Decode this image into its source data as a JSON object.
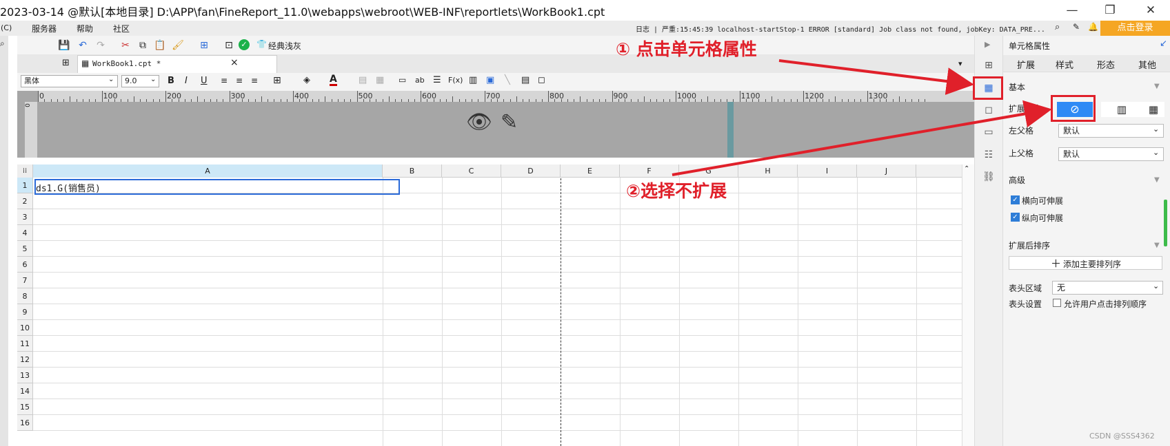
{
  "window": {
    "title": "2023-03-14 @默认[本地目录]    D:\\APP\\fan\\FineReport_11.0\\webapps\\webroot\\WEB-INF\\reportlets\\WorkBook1.cpt",
    "min": "—",
    "max": "❐",
    "close": "✕"
  },
  "menu": {
    "c": "(C)",
    "server": "服务器",
    "help": "帮助",
    "community": "社区"
  },
  "log": "日志 | 严重:15:45:39 localhost-startStop-1 ERROR [standard] Job class not found, jobKey: DATA_PRE...",
  "login": "点击登录",
  "toolbar": {
    "style_label": "经典浅灰"
  },
  "tab": {
    "name": "WorkBook1.cpt *",
    "close": "×"
  },
  "format": {
    "font": "黑体",
    "size": "9.0"
  },
  "ruler": {
    "ticks": [
      "0",
      "100",
      "200",
      "300",
      "400",
      "500",
      "600",
      "700",
      "800",
      "900",
      "1000",
      "1100",
      "1200",
      "1300"
    ],
    "vzero": "0"
  },
  "sheet": {
    "columns": [
      "A",
      "B",
      "C",
      "D",
      "E",
      "F",
      "G",
      "H",
      "I",
      "J"
    ],
    "rows": [
      "1",
      "2",
      "3",
      "4",
      "5",
      "6",
      "7",
      "8",
      "9",
      "10",
      "11",
      "12",
      "13",
      "14",
      "15",
      "16"
    ],
    "cell_a1": "ds1.G(销售员)"
  },
  "panel": {
    "title": "单元格属性",
    "tabs": [
      "扩展",
      "样式",
      "形态",
      "其他"
    ],
    "basic": "基本",
    "expand_dir": "扩展方向",
    "left_parent": "左父格",
    "left_parent_value": "默认",
    "up_parent": "上父格",
    "up_parent_value": "默认",
    "advanced": "高级",
    "h_stretch": "横向可伸展",
    "v_stretch": "纵向可伸展",
    "sort": "扩展后排序",
    "add_sort": "添加主要排列序",
    "header_area": "表头区域",
    "header_area_value": "无",
    "header_setting": "表头设置",
    "allow_sort": "允许用户点击排列顺序"
  },
  "annotations": {
    "step1": "① 点击单元格属性",
    "step2": "②选择不扩展"
  },
  "watermark": "CSDN @SSS4362"
}
